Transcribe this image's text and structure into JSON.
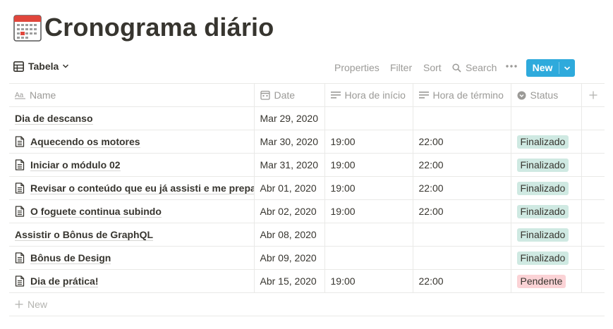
{
  "page": {
    "icon": "calendar-icon",
    "title": "Cronograma diário"
  },
  "toolbar": {
    "view_label": "Tabela",
    "properties": "Properties",
    "filter": "Filter",
    "sort": "Sort",
    "search": "Search",
    "new": "New"
  },
  "table": {
    "columns": [
      {
        "label": "Name",
        "icon": "text-property-icon"
      },
      {
        "label": "Date",
        "icon": "calendar-property-icon"
      },
      {
        "label": "Hora de início",
        "icon": "lines-property-icon"
      },
      {
        "label": "Hora de término",
        "icon": "lines-property-icon"
      },
      {
        "label": "Status",
        "icon": "select-property-icon"
      }
    ],
    "rows": [
      {
        "name": "Dia de descanso",
        "doc": false,
        "date": "Mar 29, 2020",
        "start": "",
        "end": "",
        "status": ""
      },
      {
        "name": "Aquecendo os motores",
        "doc": true,
        "date": "Mar 30, 2020",
        "start": "19:00",
        "end": "22:00",
        "status": "Finalizado"
      },
      {
        "name": "Iniciar o módulo 02",
        "doc": true,
        "date": "Mar 31, 2020",
        "start": "19:00",
        "end": "22:00",
        "status": "Finalizado"
      },
      {
        "name": "Revisar o conteúdo que eu já assisti e me preparar",
        "doc": true,
        "date": "Abr 01, 2020",
        "start": "19:00",
        "end": "22:00",
        "status": "Finalizado"
      },
      {
        "name": "O foguete continua subindo",
        "doc": true,
        "date": "Abr 02, 2020",
        "start": "19:00",
        "end": "22:00",
        "status": "Finalizado"
      },
      {
        "name": "Assistir o Bônus de GraphQL",
        "doc": false,
        "date": "Abr 08, 2020",
        "start": "",
        "end": "",
        "status": "Finalizado"
      },
      {
        "name": "Bônus de Design",
        "doc": true,
        "date": "Abr 09, 2020",
        "start": "",
        "end": "",
        "status": "Finalizado"
      },
      {
        "name": "Dia de prática!",
        "doc": true,
        "date": "Abr 15, 2020",
        "start": "19:00",
        "end": "22:00",
        "status": "Pendente"
      }
    ],
    "new_row_label": "New"
  },
  "status_colors": {
    "Finalizado": "#cfe9e2",
    "Pendente": "#fbd3d6"
  },
  "colors": {
    "accent": "#2eaadc",
    "text": "#37352f",
    "muted": "#9b9a97"
  }
}
